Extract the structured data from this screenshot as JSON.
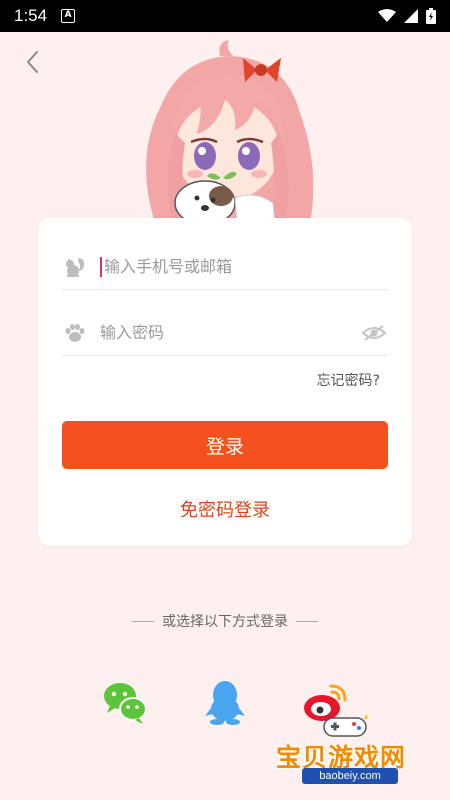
{
  "status_bar": {
    "time": "1:54",
    "badge": "A"
  },
  "login": {
    "phone_placeholder": "输入手机号或邮箱",
    "password_placeholder": "输入密码",
    "forgot_label": "忘记密码?",
    "login_button": "登录",
    "passwordless_label": "免密码登录"
  },
  "other_login": {
    "divider_label": "或选择以下方式登录",
    "options": [
      "wechat-icon",
      "qq-icon",
      "weibo-icon"
    ]
  },
  "watermark": {
    "title": "宝贝游戏网",
    "url": "baobeiy.com"
  },
  "colors": {
    "background": "#fdf0ef",
    "primary": "#f5511e",
    "link": "#e0431b",
    "wechat": "#5cc43b",
    "qq": "#4aa5f0",
    "weibo": "#e6162d"
  }
}
